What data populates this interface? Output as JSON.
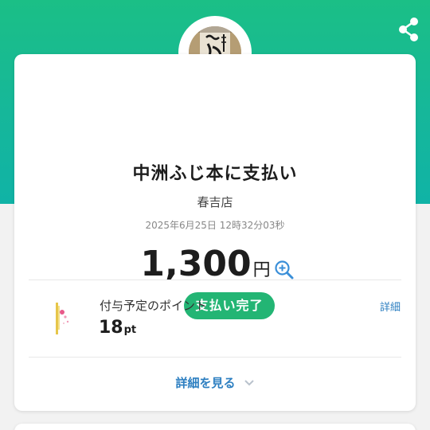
{
  "merchant": {
    "name": "中洲ふじ本に支払い",
    "store": "春吉店",
    "logo_text": "中洲 ふじ本"
  },
  "payment": {
    "datetime": "2025年6月25日 12時32分03秒",
    "amount": "1,300",
    "currency_unit": "円",
    "status": "支払い完了"
  },
  "points": {
    "label": "付与予定のポイント",
    "value": "18",
    "unit": "pt",
    "detail_link": "詳細"
  },
  "footer": {
    "more_label": "詳細を見る"
  },
  "icons": {
    "share": "share-icon",
    "zoom": "zoom-in-icon",
    "chevron": "chevron-down-icon",
    "points": "points-icon"
  },
  "colors": {
    "header": "#16b79a",
    "status_badge": "#23b574",
    "link": "#2d7fc1",
    "zoom": "#3a8fd8"
  }
}
